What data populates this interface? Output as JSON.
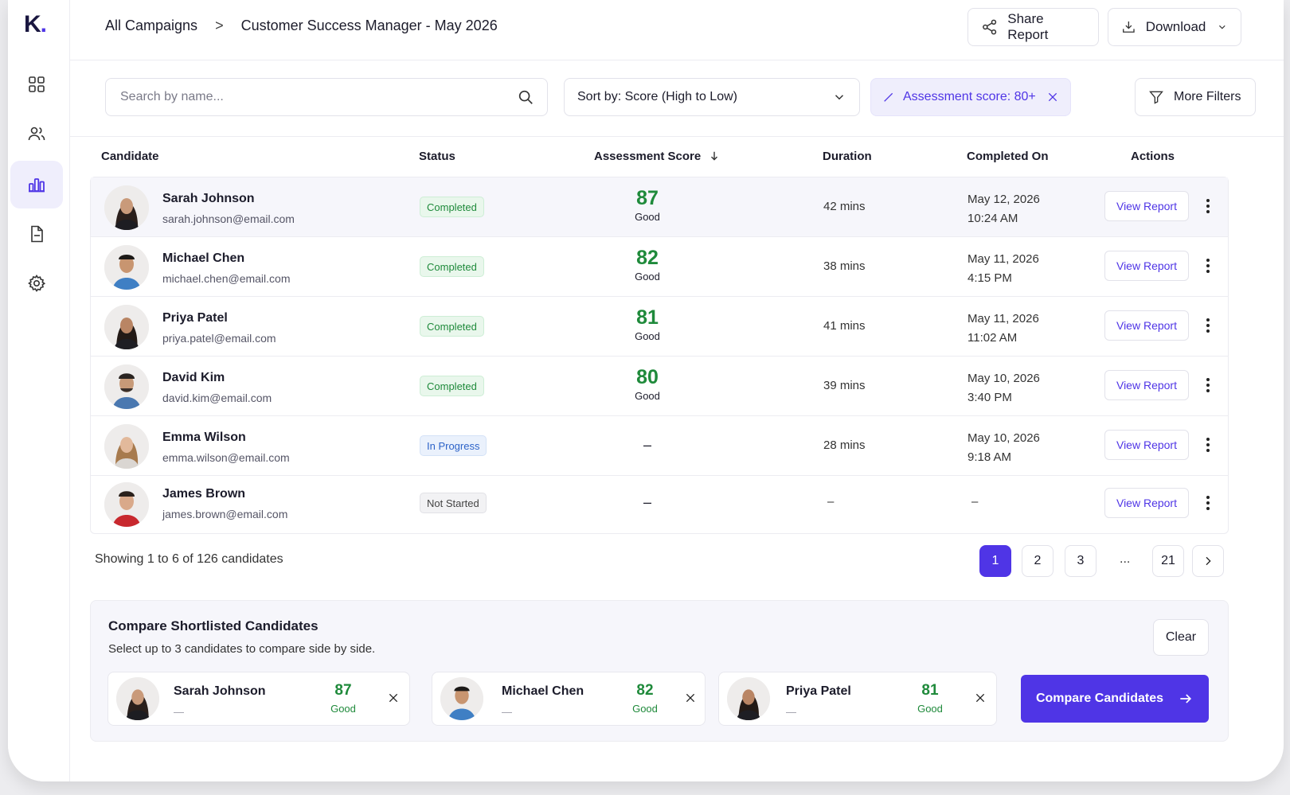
{
  "app": {
    "logo": "K",
    "logo_dot": "."
  },
  "breadcrumb": {
    "root": "All Campaigns",
    "separator": ">",
    "current": "Customer Success Manager - May 2026"
  },
  "header": {
    "share_label": "Share Report",
    "download_label": "Download"
  },
  "filters": {
    "search_placeholder": "Search by name...",
    "sort_label": "Sort by: Score (High to Low)",
    "active_chip": "Assessment score: 80+",
    "more_filters_label": "More Filters"
  },
  "table": {
    "columns": {
      "candidate": "Candidate",
      "status": "Status",
      "score": "Assessment Score",
      "duration": "Duration",
      "completed_on": "Completed On",
      "actions": "Actions"
    },
    "rows": [
      {
        "name": "Sarah Johnson",
        "email": "sarah.johnson@email.com",
        "status": "Completed",
        "status_kind": "completed",
        "score": "87",
        "score_label": "Good",
        "duration": "42 mins",
        "date": "May 12, 2026",
        "time": "10:24 AM",
        "action": "View Report"
      },
      {
        "name": "Michael Chen",
        "email": "michael.chen@email.com",
        "status": "Completed",
        "status_kind": "completed",
        "score": "82",
        "score_label": "Good",
        "duration": "38 mins",
        "date": "May 11, 2026",
        "time": "4:15 PM",
        "action": "View Report"
      },
      {
        "name": "Priya Patel",
        "email": "priya.patel@email.com",
        "status": "Completed",
        "status_kind": "completed",
        "score": "81",
        "score_label": "Good",
        "duration": "41 mins",
        "date": "May 11, 2026",
        "time": "11:02 AM",
        "action": "View Report"
      },
      {
        "name": "David Kim",
        "email": "david.kim@email.com",
        "status": "Completed",
        "status_kind": "completed",
        "score": "80",
        "score_label": "Good",
        "duration": "39 mins",
        "date": "May 10, 2026",
        "time": "3:40 PM",
        "action": "View Report"
      },
      {
        "name": "Emma Wilson",
        "email": "emma.wilson@email.com",
        "status": "In Progress",
        "status_kind": "inprogress",
        "score_dash": "–",
        "duration": "28 mins",
        "date": "May 10, 2026",
        "time": "9:18 AM",
        "action": "View Report"
      },
      {
        "name": "James Brown",
        "email": "james.brown@email.com",
        "status": "Not Started",
        "status_kind": "notstarted",
        "score_dash": "–",
        "duration": "–",
        "date_dash": "–",
        "action": "View Report"
      }
    ]
  },
  "pagination": {
    "summary": "Showing 1 to 6 of 126 candidates",
    "pages": [
      "1",
      "2",
      "3"
    ],
    "ellipsis": "...",
    "last_page": "21",
    "current_page": "1"
  },
  "compare": {
    "title": "Compare Shortlisted Candidates",
    "subtitle": "Select up to 3 candidates to compare side by side.",
    "clear_label": "Clear",
    "cards": [
      {
        "name": "Sarah Johnson",
        "line": "—",
        "score": "87",
        "label": "Good"
      },
      {
        "name": "Michael Chen",
        "line": "—",
        "score": "82",
        "label": "Good"
      },
      {
        "name": "Priya Patel",
        "line": "—",
        "score": "81",
        "label": "Good"
      }
    ],
    "button_label": "Compare Candidates"
  },
  "colors": {
    "accent": "#4f35e6",
    "success": "#1f8a3b",
    "info": "#2d63c8"
  },
  "icons": [
    "dashboard-icon",
    "users-icon",
    "analytics-icon",
    "document-icon",
    "settings-icon",
    "share-icon",
    "download-icon",
    "chevron-down-icon",
    "search-icon",
    "pencil-icon",
    "close-icon",
    "filter-icon",
    "arrow-down-icon",
    "kebab-icon",
    "chevron-right-icon",
    "arrow-right-icon"
  ]
}
